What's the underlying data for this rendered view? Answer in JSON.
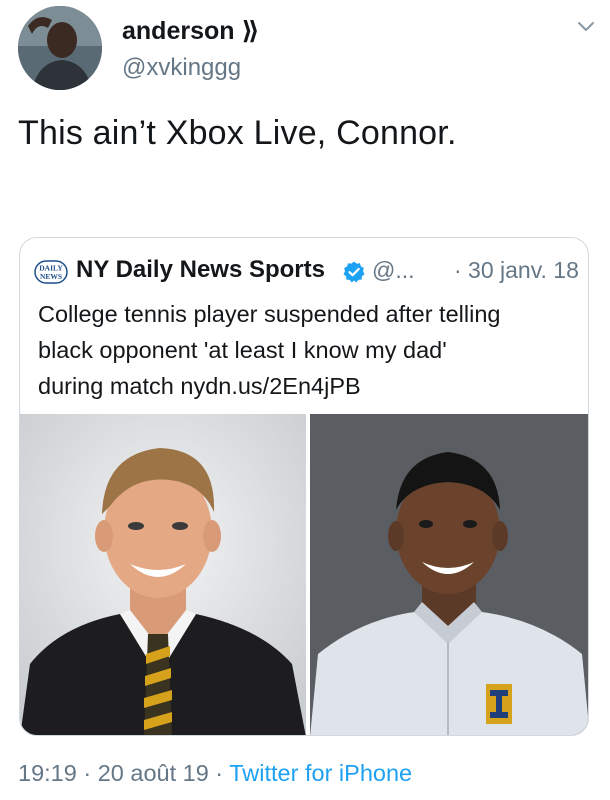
{
  "author": {
    "display_name": "anderson ⟫",
    "handle": "@xvkinggg"
  },
  "tweet": {
    "text": "This ain’t Xbox Live, Connor."
  },
  "quoted": {
    "logo_text": "DAILY NEWS",
    "name": "NY Daily News Sports",
    "handle": "@...",
    "date": "· 30 janv. 18",
    "lines": [
      "College tennis player suspended after telling",
      "black opponent 'at least I know my dad'",
      "during match nydn.us/2En4jPB"
    ]
  },
  "footer": {
    "time": "19:19",
    "sep1": " · ",
    "date": "20 août 19",
    "sep2": " · ",
    "source": "Twitter for iPhone"
  },
  "colors": {
    "text": "#14171a",
    "secondary": "#657786",
    "link": "#1da1f2",
    "verified": "#1da1f2",
    "border": "#cfd9de"
  },
  "icons": {
    "verified": "verified-badge-icon",
    "caret": "chevron-down-icon",
    "logo": "daily-news-logo"
  }
}
